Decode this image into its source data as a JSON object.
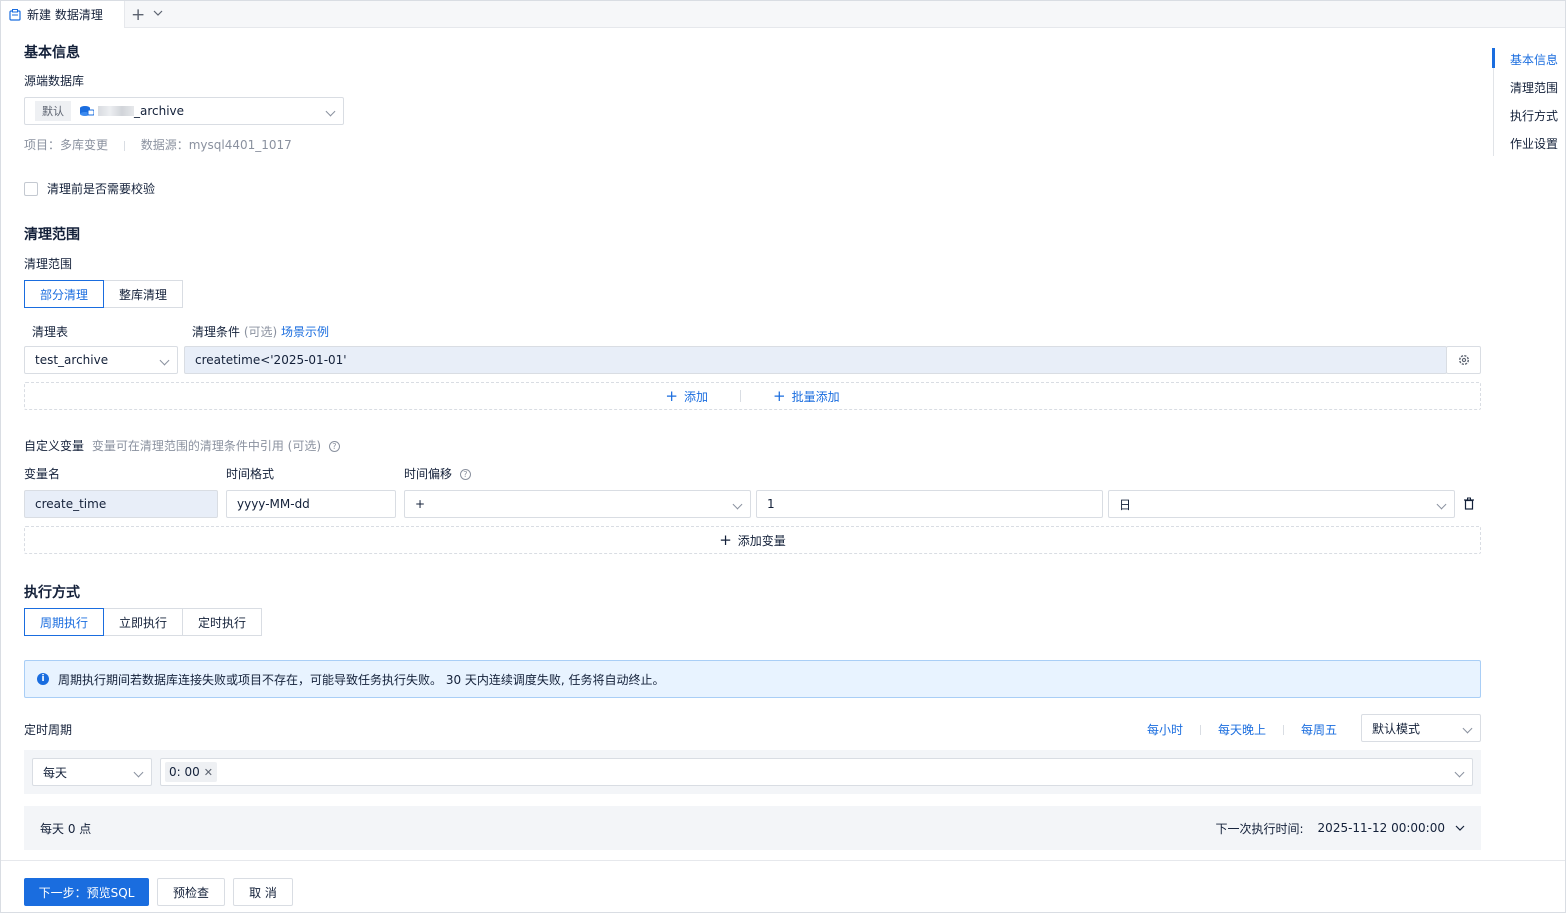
{
  "tab": {
    "title": "新建 数据清理",
    "add_icon": "plus-icon",
    "more_icon": "chevron-down-icon"
  },
  "basic": {
    "title": "基本信息",
    "source_db_label": "源端数据库",
    "db_tag": "默认",
    "db_name_suffix": "_archive",
    "project_label": "项目：",
    "project_value": "多库变更",
    "datasource_label": "数据源：",
    "datasource_value": "mysql4401_1017",
    "check_label": "清理前是否需要校验",
    "check_checked": false
  },
  "scope": {
    "title": "清理范围",
    "field_label": "清理范围",
    "modes": [
      "部分清理",
      "整库清理"
    ],
    "active_mode": 0,
    "table_col_label": "清理表",
    "condition_col_label": "清理条件",
    "condition_optional": "(可选)",
    "scenario_link": "场景示例",
    "table_value": "test_archive",
    "condition_value": "createtime<'2025-01-01'",
    "add_label": "添加",
    "batch_add_label": "批量添加"
  },
  "variables": {
    "title": "自定义变量",
    "hint": "变量可在清理范围的清理条件中引用 (可选)",
    "name_col": "变量名",
    "format_col": "时间格式",
    "offset_col": "时间偏移",
    "name_value": "create_time",
    "format_value": "yyyy-MM-dd",
    "sign_value": "+",
    "offset_value": "1",
    "unit_value": "日",
    "add_variable_label": "添加变量"
  },
  "execution": {
    "title": "执行方式",
    "modes": [
      "周期执行",
      "立即执行",
      "定时执行"
    ],
    "active_mode": 0,
    "notice": "周期执行期间若数据库连接失败或项目不存在，可能导致任务执行失败。 30 天内连续调度失败, 任务将自动终止。",
    "period_label": "定时周期",
    "quick_links": [
      "每小时",
      "每天晚上",
      "每周五"
    ],
    "mode_select": "默认模式",
    "freq_value": "每天",
    "time_tag": "0: 00",
    "summary": "每天 0 点",
    "next_run_label": "下一次执行时间:",
    "next_run_value": "2025-11-12 00:00:00"
  },
  "anchors": [
    "基本信息",
    "清理范围",
    "执行方式",
    "作业设置"
  ],
  "active_anchor": 0,
  "footer": {
    "next_label": "下一步：预览SQL",
    "precheck_label": "预检查",
    "cancel_label": "取 消"
  },
  "colors": {
    "primary": "#1a6ddf",
    "notice_bg": "#e8f3ff",
    "filled_bg": "#e8eef8"
  }
}
